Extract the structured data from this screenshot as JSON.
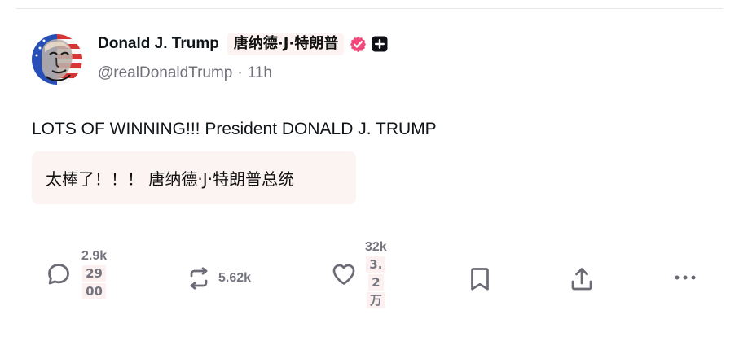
{
  "post": {
    "author": {
      "display_name": "Donald J. Trump",
      "display_name_translation": "唐纳德·J·特朗普",
      "handle": "@realDonaldTrump",
      "separator": "·",
      "timestamp": "11h",
      "verified_badge_color": "#f04a7c",
      "avatar_icon": "flag-portrait-avatar"
    },
    "text": "LOTS OF WINNING!!! President DONALD J. TRUMP",
    "translation": "太棒了！！！ 唐纳德·J·特朗普总统"
  },
  "actions": {
    "reply": {
      "icon": "comment-icon",
      "count": "2.9k",
      "count_translation_lines": [
        "29",
        "00"
      ]
    },
    "repost": {
      "icon": "repost-icon",
      "count": "5.62k"
    },
    "like": {
      "icon": "heart-icon",
      "count": "32k",
      "count_translation_lines": [
        "3.",
        "2",
        "万"
      ]
    },
    "bookmark": {
      "icon": "bookmark-icon"
    },
    "share": {
      "icon": "share-icon"
    },
    "more": {
      "icon": "more-icon"
    }
  },
  "colors": {
    "text": "#0f1419",
    "muted": "#72717a",
    "translation_background": "#fcf4f3"
  }
}
